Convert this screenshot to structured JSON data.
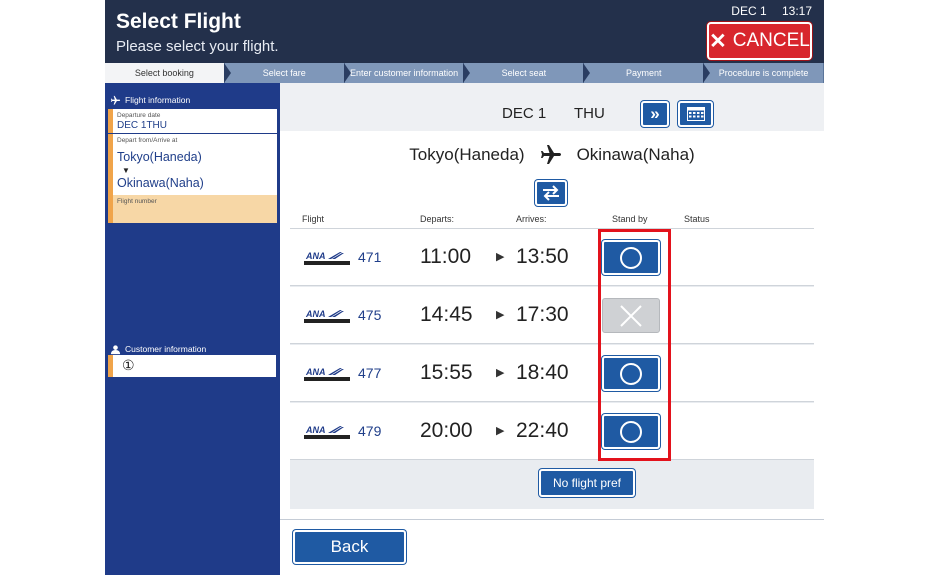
{
  "header": {
    "title": "Select Flight",
    "subtitle": "Please select your flight.",
    "date": "DEC 1",
    "time": "13:17",
    "cancel_label": "CANCEL"
  },
  "steps": [
    {
      "label": "Select booking",
      "active": true
    },
    {
      "label": "Select fare",
      "active": false
    },
    {
      "label": "Enter customer information",
      "active": false
    },
    {
      "label": "Select seat",
      "active": false
    },
    {
      "label": "Payment",
      "active": false
    },
    {
      "label": "Procedure is complete",
      "active": false
    }
  ],
  "sidebar": {
    "flight_info_heading": "Flight information",
    "departure_date_label": "Departure date",
    "departure_date_value": "DEC 1THU",
    "depart_arrive_label": "Depart from/Arrive at",
    "depart_from": "Tokyo(Haneda)",
    "arrive_at": "Okinawa(Naha)",
    "flight_number_label": "Flight number",
    "customer_info_heading": "Customer information",
    "customer_number": "①"
  },
  "main": {
    "date": "DEC 1",
    "day": "THU",
    "origin": "Tokyo(Haneda)",
    "destination": "Okinawa(Naha)",
    "columns": {
      "flight": "Flight",
      "departs": "Departs:",
      "arrives": "Arrives:",
      "standby": "Stand by",
      "status": "Status"
    },
    "flights": [
      {
        "airline": "ANA",
        "number": "471",
        "departs": "11:00",
        "arrives": "13:50",
        "standby_available": true
      },
      {
        "airline": "ANA",
        "number": "475",
        "departs": "14:45",
        "arrives": "17:30",
        "standby_available": false
      },
      {
        "airline": "ANA",
        "number": "477",
        "departs": "15:55",
        "arrives": "18:40",
        "standby_available": true
      },
      {
        "airline": "ANA",
        "number": "479",
        "departs": "20:00",
        "arrives": "22:40",
        "standby_available": true
      }
    ],
    "no_pref_label": "No flight pref",
    "back_label": "Back"
  },
  "colors": {
    "header_bg": "#23304b",
    "sidebar_bg": "#1f3b89",
    "button_blue": "#1f5aa3",
    "cancel_red": "#d8262d",
    "accent_orange": "#f0a44a",
    "highlight_red": "#e3121c"
  }
}
